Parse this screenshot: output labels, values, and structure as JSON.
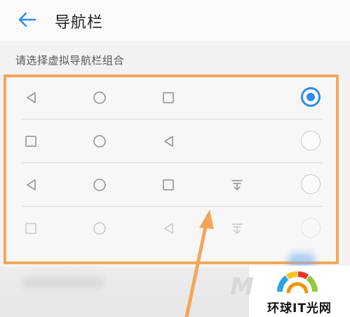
{
  "header": {
    "back_icon": "back-arrow-icon",
    "title": "导航栏"
  },
  "section": {
    "label": "请选择虚拟导航栏组合"
  },
  "options": [
    {
      "buttons": [
        "back-triangle-icon",
        "home-circle-icon",
        "recent-square-icon",
        ""
      ],
      "selected": true,
      "faded": false
    },
    {
      "buttons": [
        "recent-square-icon",
        "home-circle-icon",
        "back-triangle-icon",
        ""
      ],
      "selected": false,
      "faded": false
    },
    {
      "buttons": [
        "back-triangle-icon",
        "home-circle-icon",
        "recent-square-icon",
        "notification-pulldown-icon"
      ],
      "selected": false,
      "faded": false
    },
    {
      "buttons": [
        "recent-square-icon",
        "home-circle-icon",
        "back-triangle-icon",
        "notification-pulldown-icon"
      ],
      "selected": false,
      "faded": true
    }
  ],
  "colors": {
    "accent": "#2d8cf0",
    "annotation": "#f2a65a"
  },
  "watermark": {
    "text": "环球IT光网"
  }
}
